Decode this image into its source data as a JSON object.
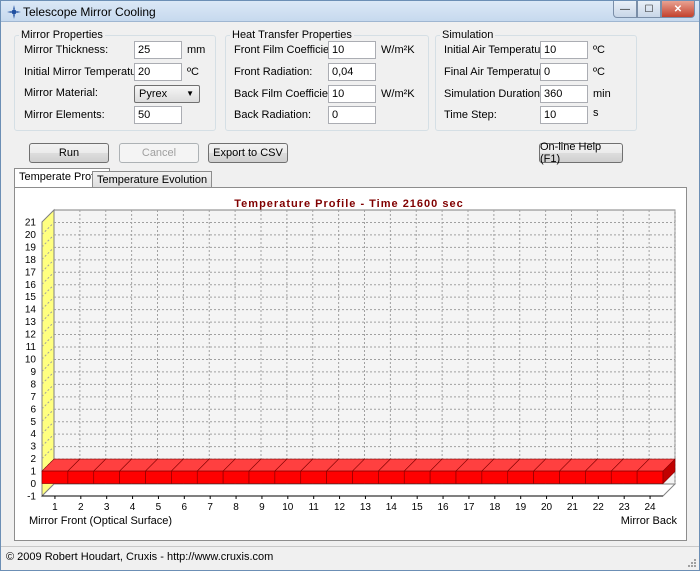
{
  "window": {
    "title": "Telescope Mirror Cooling",
    "controls": {
      "minimize": "—",
      "maximize": "☐",
      "close": "✕"
    }
  },
  "mirror": {
    "title": "Mirror Properties",
    "thickness_label": "Mirror Thickness:",
    "thickness_value": "25",
    "thickness_unit": "mm",
    "init_temp_label": "Initial Mirror Temperature:",
    "init_temp_value": "20",
    "init_temp_unit": "ºC",
    "material_label": "Mirror Material:",
    "material_value": "Pyrex",
    "elements_label": "Mirror Elements:",
    "elements_value": "50"
  },
  "heat": {
    "title": "Heat Transfer Properties",
    "front_film_label": "Front Film Coefficient:",
    "front_film_value": "10",
    "front_film_unit": "W/m²K",
    "front_rad_label": "Front Radiation:",
    "front_rad_value": "0,04",
    "back_film_label": "Back Film Coefficient:",
    "back_film_value": "10",
    "back_film_unit": "W/m²K",
    "back_rad_label": "Back Radiation:",
    "back_rad_value": "0"
  },
  "sim": {
    "title": "Simulation",
    "init_air_label": "Initial Air Temperature:",
    "init_air_value": "10",
    "init_air_unit": "ºC",
    "final_air_label": "Final Air Temperature:",
    "final_air_value": "0",
    "final_air_unit": "ºC",
    "duration_label": "Simulation Duration:",
    "duration_value": "360",
    "duration_unit": "min",
    "timestep_label": "Time Step:",
    "timestep_value": "10",
    "timestep_unit": "s"
  },
  "buttons": {
    "run": "Run",
    "cancel": "Cancel",
    "export": "Export to CSV",
    "help": "On-line Help (F1)"
  },
  "tabs": {
    "profile": "Temperate Profile",
    "evolution": "Temperature Evolution"
  },
  "chart_data": {
    "type": "bar",
    "title": "Temperature Profile - Time 21600 sec",
    "categories": [
      "1",
      "2",
      "3",
      "4",
      "5",
      "6",
      "7",
      "8",
      "9",
      "10",
      "11",
      "12",
      "13",
      "14",
      "15",
      "16",
      "17",
      "18",
      "19",
      "20",
      "21",
      "22",
      "23",
      "24"
    ],
    "values": [
      1,
      1,
      1,
      1,
      1,
      1,
      1,
      1,
      1,
      1,
      1,
      1,
      1,
      1,
      1,
      1,
      1,
      1,
      1,
      1,
      1,
      1,
      1,
      1
    ],
    "y_ticks": [
      "-1",
      "0",
      "1",
      "2",
      "3",
      "4",
      "5",
      "6",
      "7",
      "8",
      "9",
      "10",
      "11",
      "12",
      "13",
      "14",
      "15",
      "16",
      "17",
      "18",
      "19",
      "20",
      "21"
    ],
    "ylim": [
      -1,
      21
    ],
    "x_left_label": "Mirror Front (Optical Surface)",
    "x_right_label": "Mirror Back",
    "grid": true,
    "colors": {
      "bar": "#ff0000",
      "wall": "#ffff80",
      "title": "#800000"
    }
  },
  "status": {
    "text": "© 2009 Robert Houdart, Cruxis  -  http://www.cruxis.com"
  }
}
